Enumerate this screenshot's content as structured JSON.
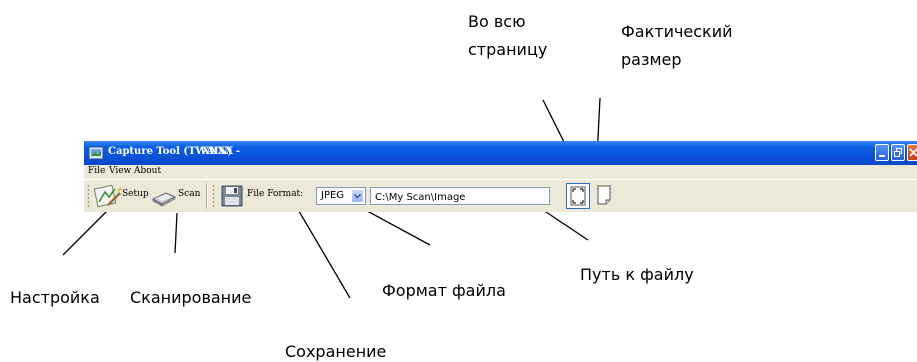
{
  "window": {
    "title": "Capture Tool (TWAIN) -",
    "document": "XXXX"
  },
  "menu": [
    "File",
    "View",
    "About"
  ],
  "toolbar": {
    "setup_label": "Setup",
    "scan_label": "Scan",
    "file_format_label": "File Format:",
    "format_value": "JPEG",
    "path_value": "C:\\My Scan\\Image"
  },
  "callouts": {
    "fit_page_line1": "Во всю",
    "fit_page_line2": "страницу",
    "actual_size_line1": "Фактический",
    "actual_size_line2": "размер",
    "setup": "Настройка",
    "scan": "Сканирование",
    "file_format": "Формат файла",
    "file_path": "Путь к файлу",
    "save": "Сохранение"
  },
  "icons": {
    "app": "capture-tool-icon",
    "setup": "setup-icon",
    "scan": "scanner-icon",
    "save": "floppy-disk-icon",
    "fit": "fit-page-icon",
    "actual": "actual-size-page-icon"
  },
  "colors": {
    "titlebar": "#0a4fd6",
    "window_bg": "#ece9d8",
    "input_border": "#7f9db9",
    "close_button": "#c2401a"
  }
}
